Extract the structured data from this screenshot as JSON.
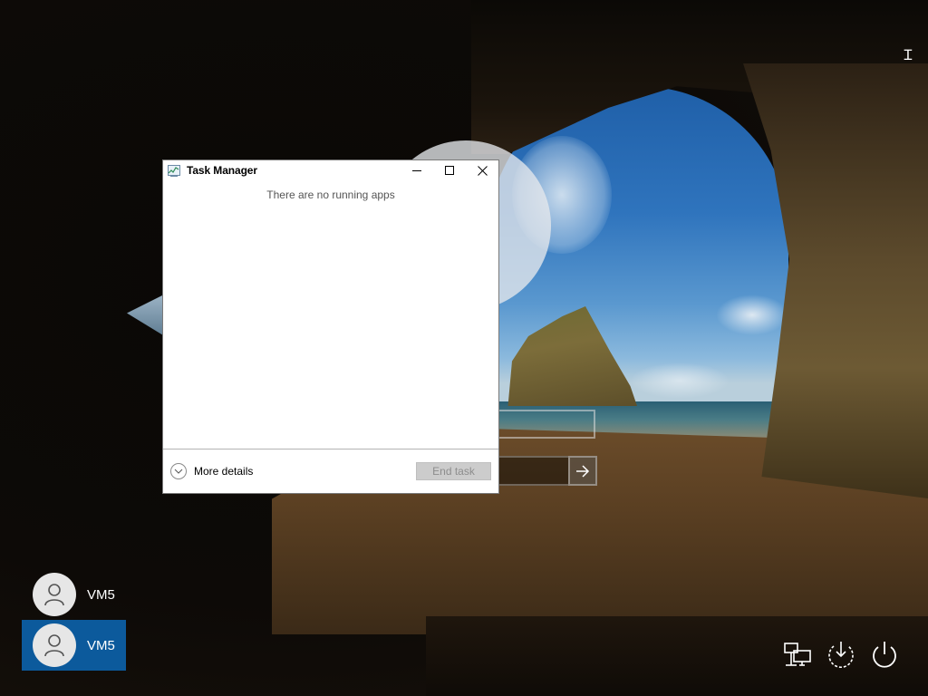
{
  "task_manager": {
    "title": "Task Manager",
    "empty_message": "There are no running apps",
    "more_details_label": "More details",
    "end_task_label": "End task",
    "minimize_icon": "minimize-icon",
    "maximize_icon": "maximize-icon",
    "close_icon": "close-icon"
  },
  "login": {
    "submit_icon": "arrow-right-icon"
  },
  "users": [
    {
      "name": "VM5",
      "selected": false
    },
    {
      "name": "VM5",
      "selected": true
    }
  ],
  "system_icons": [
    "network-icon",
    "ease-of-access-icon",
    "power-icon"
  ],
  "colors": {
    "selected_user": "#0c5a9c",
    "end_task_disabled": "#cccccc"
  }
}
